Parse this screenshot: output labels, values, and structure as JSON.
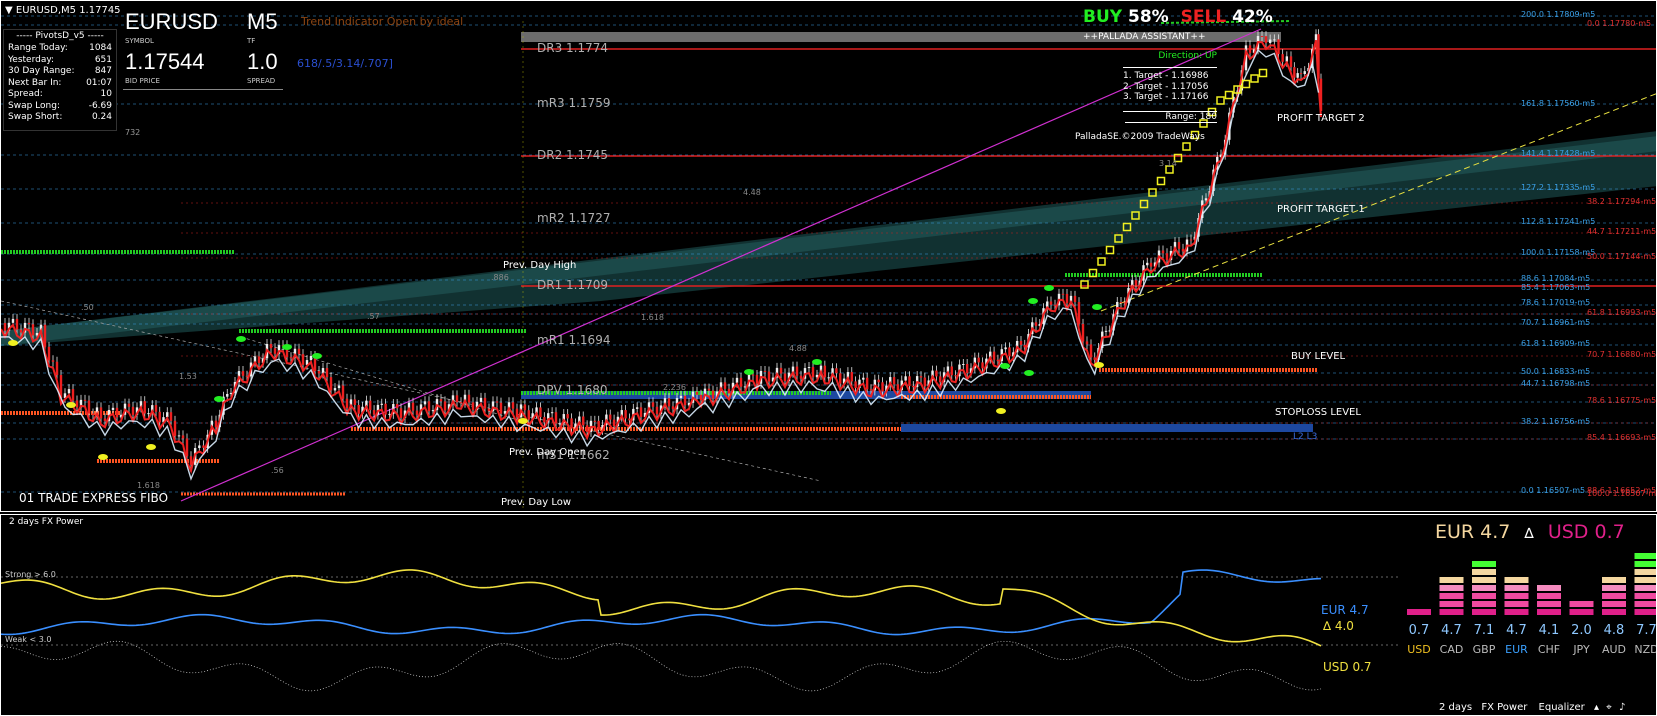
{
  "main": {
    "window_title": "EURUSD,M5  1.17745",
    "info_panel": {
      "title": "PivotsD_v5",
      "rows": [
        {
          "label": "Range  Today:",
          "value": "1084"
        },
        {
          "label": "Yesterday:",
          "value": "651"
        },
        {
          "label": "30 Day Range:",
          "value": "847"
        },
        {
          "label": "Next Bar In:",
          "value": "01:07"
        },
        {
          "label": "Spread:",
          "value": "10"
        },
        {
          "label": "Swap  Long:",
          "value": "-6.69"
        },
        {
          "label": "Swap  Short:",
          "value": "0.24"
        }
      ],
      "extra": "732"
    },
    "symbol_panel": {
      "symbol": "EURUSD",
      "symbol_caption": "SYMBOL",
      "tf": "M5",
      "tf_caption": "TF",
      "bid": "1.17544",
      "bid_caption": "BID PRICE",
      "spread": "1.0",
      "spread_caption": "SPREAD"
    },
    "trend_indicator": "Trend Indicator Open by ideal",
    "fib_ratios": "618/.5/3.14/.707]",
    "pallada": {
      "buy_label": "BUY",
      "buy_pct": "58%",
      "sell_label": "SELL",
      "sell_pct": "42%",
      "title": "++PALLADA ASSISTANT++",
      "direction": "Direction: UP",
      "targets": [
        "1. Target - 1.16986",
        "2. Target - 1.17056",
        "3. Target - 1.17166"
      ],
      "range": "Range: 180",
      "copyright": "PalladaSE.©2009 TradeWays"
    },
    "pivots": [
      {
        "label": "DR3  1.1774"
      },
      {
        "label": "mR3  1.1759"
      },
      {
        "label": "DR2  1.1745"
      },
      {
        "label": "mR2  1.1727"
      },
      {
        "label": "DR1  1.1709"
      },
      {
        "label": "mR1  1.1694"
      },
      {
        "label": "DPV  1.1680"
      },
      {
        "label": "mS1  1.1662"
      }
    ],
    "prev_day_high": "Prev. Day High",
    "prev_day_open": "Prev. Day Open",
    "prev_day_low": "Prev. Day Low",
    "trade_express": "01 TRADE EXPRESS FIBO",
    "targets_right": {
      "pt2": "PROFIT TARGET 2",
      "pt1": "PROFIT TARGET 1",
      "buy_level": "BUY LEVEL",
      "stoploss": "STOPLOSS LEVEL",
      "l2l3": "L2 L3"
    },
    "fibo_right": [
      {
        "text": "200.0  1.17809-m5",
        "color": "#3aa0e8"
      },
      {
        "text": "0.0  1.17780-m5",
        "color": "#e03030"
      },
      {
        "text": "161.8  1.17560-m5",
        "color": "#3aa0e8"
      },
      {
        "text": "141.4  1.17428-m5",
        "color": "#3aa0e8"
      },
      {
        "text": "127.2  1.17335-m5",
        "color": "#3aa0e8"
      },
      {
        "text": "38.2  1.17294-m5",
        "color": "#e03030"
      },
      {
        "text": "112.8  1.17241-m5",
        "color": "#3aa0e8"
      },
      {
        "text": "44.7  1.17211-m5",
        "color": "#e03030"
      },
      {
        "text": "100.0  1.17158-m5",
        "color": "#3aa0e8"
      },
      {
        "text": "50.0  1.17144-m5",
        "color": "#e03030"
      },
      {
        "text": "88.6  1.17084-m5",
        "color": "#3aa0e8"
      },
      {
        "text": "85.4  1.17063-m5",
        "color": "#3aa0e8"
      },
      {
        "text": "78.6  1.17019-m5",
        "color": "#3aa0e8"
      },
      {
        "text": "61.8  1.16993-m5",
        "color": "#e03030"
      },
      {
        "text": "70.7  1.16961-m5",
        "color": "#3aa0e8"
      },
      {
        "text": "61.8  1.16909-m5",
        "color": "#3aa0e8"
      },
      {
        "text": "70.7  1.16880-m5",
        "color": "#e03030"
      },
      {
        "text": "50.0  1.16833-m5",
        "color": "#3aa0e8"
      },
      {
        "text": "44.7  1.16798-m5",
        "color": "#3aa0e8"
      },
      {
        "text": "78.6  1.16775-m5",
        "color": "#e03030"
      },
      {
        "text": "38.2  1.16756-m5",
        "color": "#3aa0e8"
      },
      {
        "text": "85.4  1.16693-m5",
        "color": "#e03030"
      },
      {
        "text": "88.6  1.16652-m5",
        "color": "#e03030"
      },
      {
        "text": "0.0  1.16507-m5",
        "color": "#3aa0e8"
      },
      {
        "text": "100.0  1.16507-m5",
        "color": "#e03030"
      }
    ],
    "misc_labels": [
      "4.48",
      "4.88",
      ".886",
      "1.618",
      "1.53",
      ".57",
      ".56",
      ".50",
      "2.236",
      "1.618",
      "3.14"
    ]
  },
  "sub": {
    "title": "2 days FX Power",
    "strong": "Strong > 6.0",
    "weak": "Weak < 3.0",
    "header_eur": "EUR 4.7",
    "header_delta": "∆",
    "header_usd": "USD 0.7",
    "eur_line": "EUR 4.7",
    "delta_line": "∆ 4.0",
    "usd_line": "USD 0.7",
    "equalizer": [
      {
        "name": "USD",
        "value": 0.7,
        "label": "0.7",
        "name_color": "#f0c020"
      },
      {
        "name": "CAD",
        "value": 4.7,
        "label": "4.7",
        "name_color": "#bbbbbb"
      },
      {
        "name": "GBP",
        "value": 7.1,
        "label": "7.1",
        "name_color": "#bbbbbb"
      },
      {
        "name": "EUR",
        "value": 4.7,
        "label": "4.7",
        "name_color": "#3aa0ff"
      },
      {
        "name": "CHF",
        "value": 4.1,
        "label": "4.1",
        "name_color": "#bbbbbb"
      },
      {
        "name": "JPY",
        "value": 2.0,
        "label": "2.0",
        "name_color": "#bbbbbb"
      },
      {
        "name": "AUD",
        "value": 4.8,
        "label": "4.8",
        "name_color": "#bbbbbb"
      },
      {
        "name": "NZD",
        "value": 7.7,
        "label": "7.7",
        "name_color": "#bbbbbb"
      }
    ],
    "footer": {
      "days": "2 days",
      "fx": "FX Power",
      "eq": "Equalizer"
    },
    "colors": {
      "eur": "#3a8fff",
      "usd": "#f0e040",
      "bar_pink": "#e0208a",
      "bar_green": "#44ff33",
      "bar_cream": "#f5d7a0"
    }
  }
}
